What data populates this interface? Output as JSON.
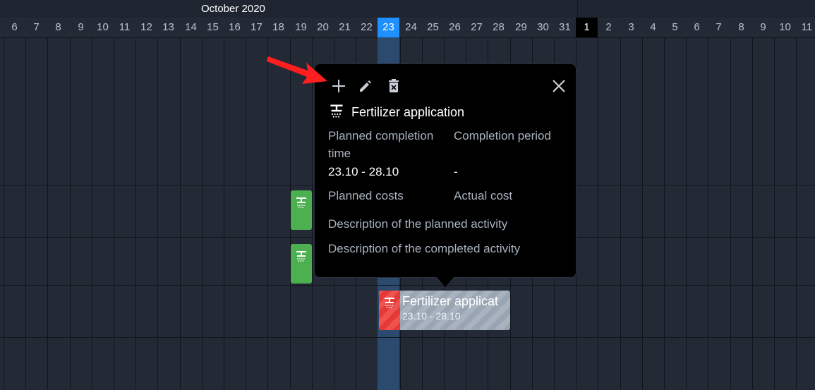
{
  "timeline": {
    "month_labels": [
      "October 2020"
    ],
    "days": [
      "6",
      "7",
      "8",
      "9",
      "10",
      "11",
      "12",
      "13",
      "14",
      "15",
      "16",
      "17",
      "18",
      "19",
      "20",
      "21",
      "22",
      "23",
      "24",
      "25",
      "26",
      "27",
      "28",
      "29",
      "30",
      "31",
      "1",
      "2",
      "3",
      "4",
      "5",
      "6",
      "7",
      "8",
      "9",
      "10",
      "11"
    ],
    "today_label": "23",
    "month_start_label": "1"
  },
  "popup": {
    "actions": [
      "add-icon",
      "edit-icon",
      "delete-icon",
      "close-icon"
    ],
    "title": "Fertilizer application",
    "planned_completion_label": "Planned completion\ntime",
    "completion_period_label": "Completion period",
    "planned_completion_value": "23.10 - 28.10",
    "completion_period_value": "-",
    "planned_costs_label": "Planned costs",
    "actual_cost_label": "Actual cost",
    "planned_desc_label": "Description of the planned activity",
    "completed_desc_label": "Description of the completed activity"
  },
  "task": {
    "title": "Fertilizer applicat",
    "dates": "23.10 - 28.10"
  },
  "colors": {
    "today": "#1e90ff",
    "task_green": "#4caf50",
    "task_red": "#e53935",
    "arrow": "#ff1f1f"
  }
}
